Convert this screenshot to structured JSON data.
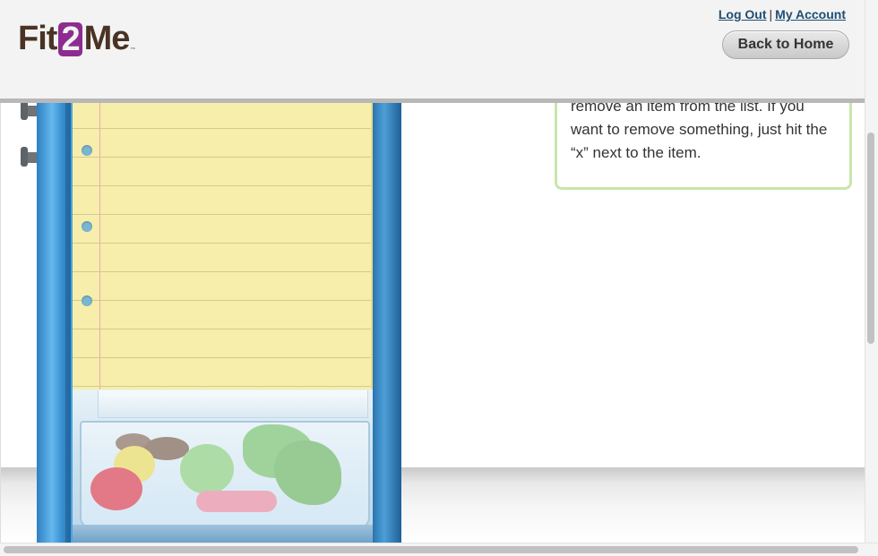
{
  "header": {
    "logo_text": {
      "pre": "Fit",
      "num": "2",
      "post": "Me",
      "tm": "™"
    },
    "logout_label": "Log Out",
    "separator": "|",
    "my_account_label": "My Account",
    "back_home_label": "Back to Home"
  },
  "info_box": {
    "text": "remove an item from the list. If you want to remove something, just hit the “x” next to the item."
  },
  "colors": {
    "brand_brown": "#4a3324",
    "brand_purple": "#8e2b90",
    "link_blue": "#1f4e73",
    "info_border_green": "#c9e6a9",
    "fridge_blue": "#2d7fc0",
    "notepad_yellow": "#f6eeaa"
  }
}
